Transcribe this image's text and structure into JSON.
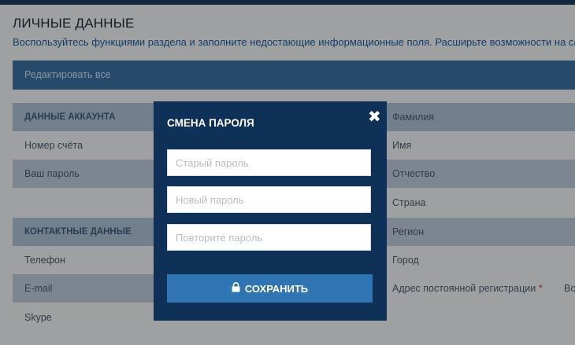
{
  "page": {
    "title": "ЛИЧНЫЕ ДАННЫЕ",
    "description": "Воспользуйтесь функциями раздела и заполните недостающие информационные поля. Расширьте возможности на сайте!"
  },
  "edit_all_label": "Редактировать все",
  "account_section": {
    "header": "ДАННЫЕ АККАУНТА",
    "rows": [
      "Номер счёта",
      "Ваш пароль"
    ]
  },
  "contact_section": {
    "header": "КОНТАКТНЫЕ ДАННЫЕ",
    "rows": [
      "Телефон",
      "E-mail",
      "Skype"
    ]
  },
  "personal_fields": [
    "Фамилия",
    "Имя",
    "Отчество",
    "Страна",
    "Регион",
    "Город",
    "Адрес постоянной регистрации"
  ],
  "required_marker": "*",
  "clipped_text": "Во",
  "modal": {
    "title": "СМЕНА ПАРОЛЯ",
    "fields": [
      {
        "placeholder": "Старый пароль",
        "value": ""
      },
      {
        "placeholder": "Новый пароль",
        "value": ""
      },
      {
        "placeholder": "Повторите пароль",
        "value": ""
      }
    ],
    "save_label": "СОХРАНИТЬ"
  },
  "icons": {
    "close": "close-icon",
    "lock": "lock-icon"
  },
  "colors": {
    "modal_bg": "#0f3057",
    "button": "#2f74b3",
    "accent": "#3a6d9e"
  }
}
